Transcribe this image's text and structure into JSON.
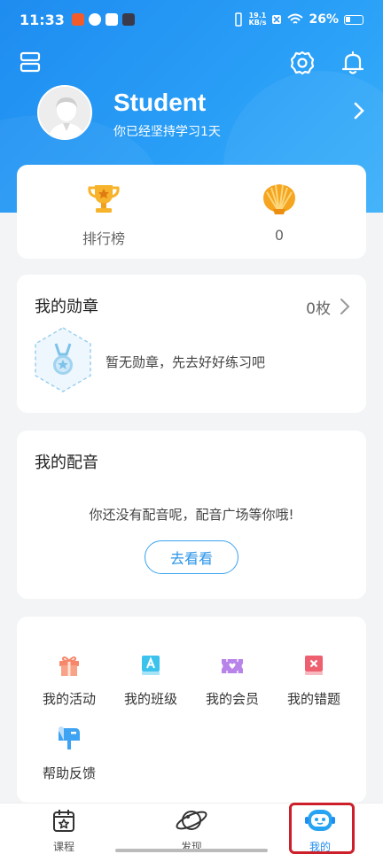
{
  "status": {
    "time": "11:33",
    "net_speed": "19.1",
    "net_unit": "KB/s",
    "battery": "26%"
  },
  "profile": {
    "name": "Student",
    "subtitle": "你已经坚持学习1天"
  },
  "stats": {
    "ranking_label": "排行榜",
    "shells_value": "0"
  },
  "medals": {
    "title": "我的勋章",
    "count": "0枚",
    "empty_text": "暂无勋章，先去好好练习吧"
  },
  "dubbing": {
    "title": "我的配音",
    "empty_text": "你还没有配音呢，配音广场等你哦!",
    "button": "去看看"
  },
  "menu": {
    "items": [
      {
        "label": "我的活动",
        "icon": "gift-icon",
        "color": "#f08a6a"
      },
      {
        "label": "我的班级",
        "icon": "class-book-icon",
        "color": "#35c0ea"
      },
      {
        "label": "我的会员",
        "icon": "vip-ticket-icon",
        "color": "#b480e8"
      },
      {
        "label": "我的错题",
        "icon": "wrong-book-icon",
        "color": "#ee5f6e"
      },
      {
        "label": "帮助反馈",
        "icon": "mailbox-icon",
        "color": "#3aa0f0"
      }
    ]
  },
  "tabs": [
    {
      "label": "课程",
      "icon": "calendar-star-icon"
    },
    {
      "label": "发现",
      "icon": "planet-icon"
    },
    {
      "label": "我的",
      "icon": "robot-face-icon",
      "active": true
    }
  ],
  "colors": {
    "brand": "#1e8cf0",
    "highlight": "#cc1f2a"
  }
}
